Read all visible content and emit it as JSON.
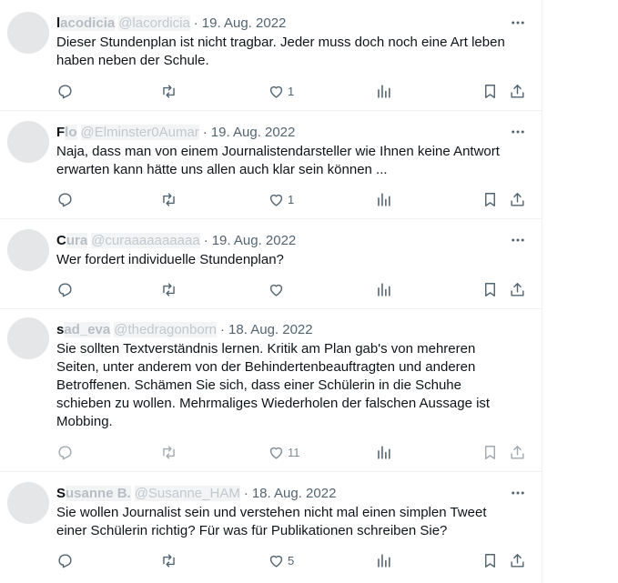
{
  "tweets": [
    {
      "name": "l",
      "name_blur": "acodicia",
      "handle": "@lacordicia",
      "separator": "·",
      "date": "19. Aug. 2022",
      "text": "Dieser Stundenplan ist nicht tragbar.  Jeder muss doch noch eine Art leben haben neben der Schule.",
      "likes": "1"
    },
    {
      "name": "F",
      "name_blur": "lo",
      "handle": "@Elminster0Aumar",
      "separator": "·",
      "date": "19. Aug. 2022",
      "text": "Naja, dass man von einem Journalistendarsteller wie Ihnen keine Antwort erwarten kann hätte uns allen auch klar sein können ...",
      "likes": "1"
    },
    {
      "name": "C",
      "name_blur": "ura",
      "handle": "@curaaaaaaaaaa",
      "separator": "·",
      "date": "19. Aug. 2022",
      "text": "Wer fordert individuelle Stundenplan?",
      "likes": ""
    },
    {
      "name": "s",
      "name_blur": "ad_eva",
      "handle": "@thedragonborn",
      "separator": "·",
      "date": "18. Aug. 2022",
      "text": "Sie sollten Textverständnis lernen. Kritik am Plan gab's von mehreren Seiten, unter anderem von der Behindertenbeauftragten und anderen Betroffenen. Schämen Sie sich, dass einer Schülerin in die Schuhe schieben zu wollen. Mehrmaliges Wiederholen der falschen Aussage ist Mobbing.",
      "likes": "11"
    },
    {
      "name": "S",
      "name_blur": "usanne B.",
      "handle": "@Susanne_HAM",
      "separator": "·",
      "date": "18. Aug. 2022",
      "text": "Sie wollen Journalist sein und verstehen nicht mal einen simplen Tweet einer Schülerin richtig? Für was für Publikationen schreiben Sie?",
      "likes": "5"
    }
  ],
  "icons": {
    "more": "more-icon",
    "reply": "reply-icon",
    "retweet": "retweet-icon",
    "like": "heart-icon",
    "views": "views-icon",
    "bookmark": "bookmark-icon",
    "share": "share-icon"
  },
  "colors": {
    "text": "#0f1419",
    "secondary": "#536471",
    "divider": "#eff3f4"
  }
}
